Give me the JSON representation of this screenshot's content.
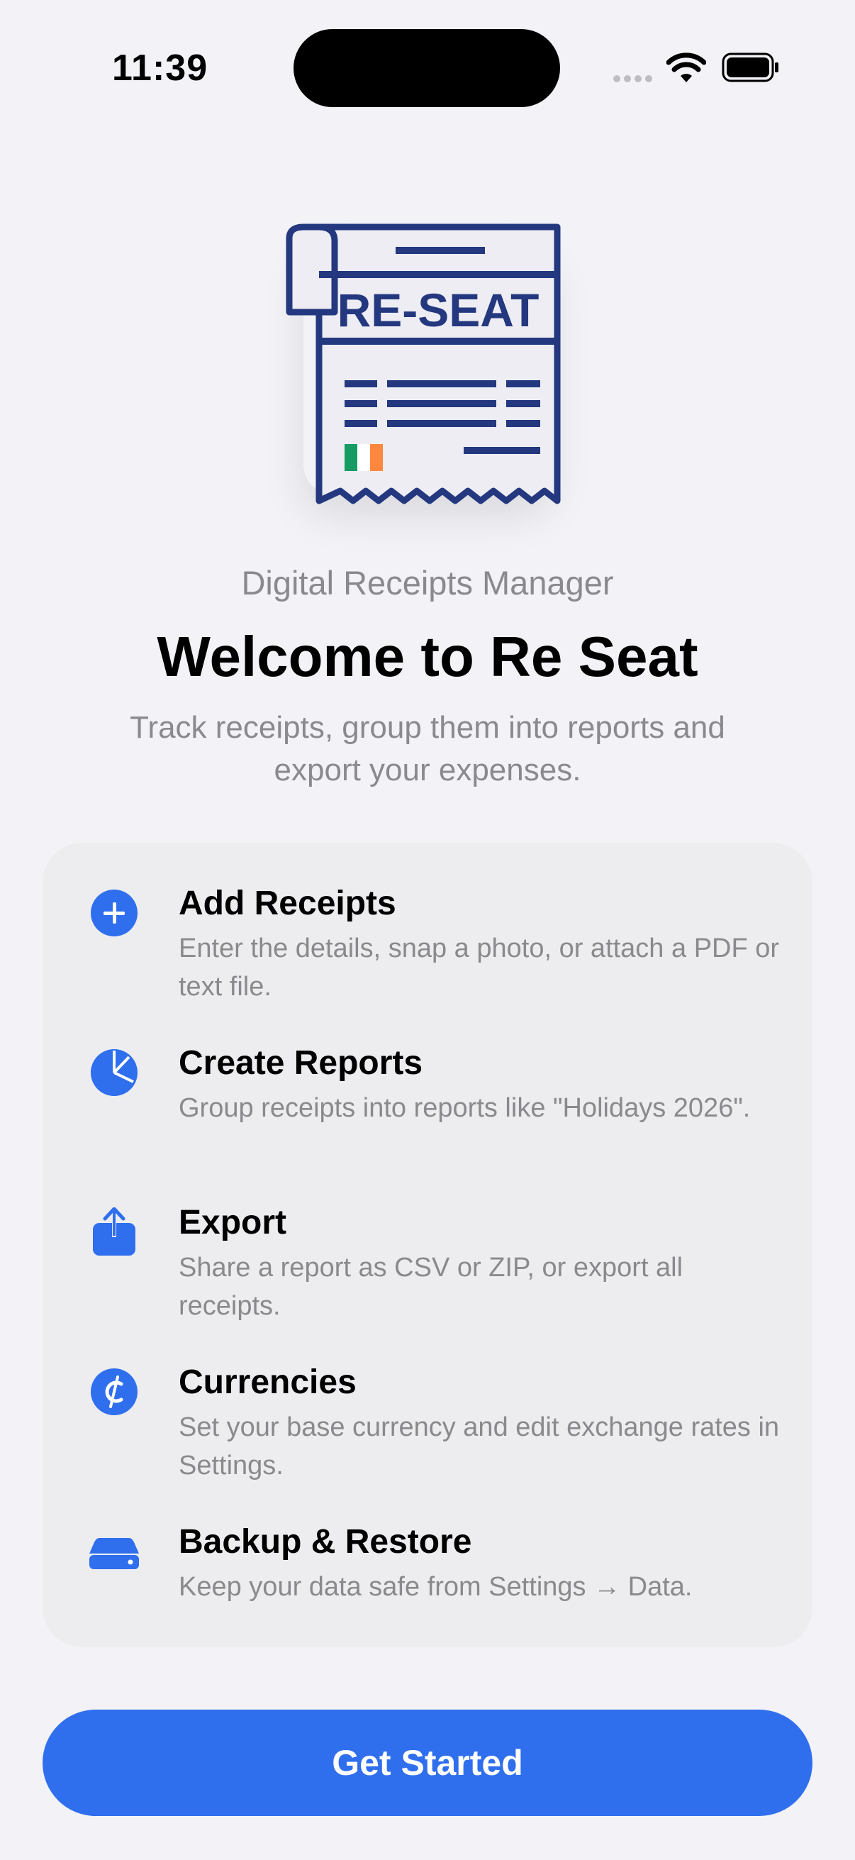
{
  "status_bar": {
    "time": "11:39"
  },
  "logo": {
    "text": "RE-SEAT",
    "colors": {
      "navy": "#24387F",
      "paper": "#EDEDF3",
      "green": "#169B62",
      "white": "#FFFFFF",
      "orange": "#FF883E"
    }
  },
  "header": {
    "subtitle": "Digital Receipts Manager",
    "title": "Welcome to Re Seat",
    "description": "Track receipts, group them into reports and export your expenses."
  },
  "features": [
    {
      "icon": "plus-circle-icon",
      "title": "Add Receipts",
      "text": "Enter the details, snap a photo, or attach a PDF or text file."
    },
    {
      "icon": "pie-chart-icon",
      "title": "Create Reports",
      "text": "Group receipts into reports like \"Holidays 2026\"."
    },
    {
      "icon": "share-icon",
      "title": "Export",
      "text": "Share a report as CSV or ZIP, or export all receipts."
    },
    {
      "icon": "currency-icon",
      "title": "Currencies",
      "text": "Set your base currency and edit exchange rates in Settings."
    },
    {
      "icon": "drive-icon",
      "title": "Backup & Restore",
      "text": "Keep your data safe from Settings → Data."
    }
  ],
  "cta": {
    "label": "Get Started"
  },
  "colors": {
    "accent": "#2F6FED",
    "background": "#F2F2F7",
    "secondary_text": "#8A8A8E"
  }
}
